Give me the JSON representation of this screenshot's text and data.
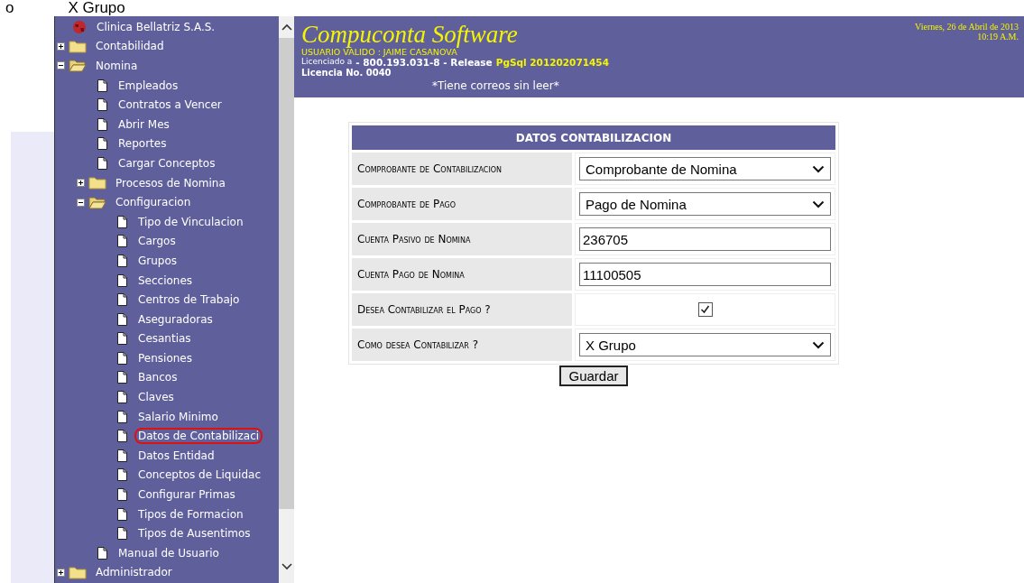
{
  "top_strip": {
    "bullet": "o",
    "text": "X Grupo"
  },
  "sidebar": {
    "tree": [
      {
        "label": "Clinica Bellatriz S.A.S.",
        "kind": "root",
        "selected": false,
        "children": [
          {
            "label": "Contabilidad",
            "kind": "folder",
            "expanded": false,
            "selected": false
          },
          {
            "label": "Nomina",
            "kind": "folder",
            "expanded": true,
            "selected": false,
            "children": [
              {
                "label": "Empleados",
                "kind": "page",
                "selected": false
              },
              {
                "label": "Contratos a Vencer",
                "kind": "page",
                "selected": false
              },
              {
                "label": "Abrir Mes",
                "kind": "page",
                "selected": false
              },
              {
                "label": "Reportes",
                "kind": "page",
                "selected": false
              },
              {
                "label": "Cargar Conceptos",
                "kind": "page",
                "selected": false
              },
              {
                "label": "Procesos de Nomina",
                "kind": "folder",
                "expanded": false,
                "selected": false
              },
              {
                "label": "Configuracion",
                "kind": "folder",
                "expanded": true,
                "selected": false,
                "children": [
                  {
                    "label": "Tipo de Vinculacion",
                    "kind": "page",
                    "selected": false
                  },
                  {
                    "label": "Cargos",
                    "kind": "page",
                    "selected": false
                  },
                  {
                    "label": "Grupos",
                    "kind": "page",
                    "selected": false
                  },
                  {
                    "label": "Secciones",
                    "kind": "page",
                    "selected": false
                  },
                  {
                    "label": "Centros de Trabajo",
                    "kind": "page",
                    "selected": false
                  },
                  {
                    "label": "Aseguradoras",
                    "kind": "page",
                    "selected": false
                  },
                  {
                    "label": "Cesantias",
                    "kind": "page",
                    "selected": false
                  },
                  {
                    "label": "Pensiones",
                    "kind": "page",
                    "selected": false
                  },
                  {
                    "label": "Bancos",
                    "kind": "page",
                    "selected": false
                  },
                  {
                    "label": "Claves",
                    "kind": "page",
                    "selected": false
                  },
                  {
                    "label": "Salario Minimo",
                    "kind": "page",
                    "selected": false
                  },
                  {
                    "label": "Datos de Contabilizaci",
                    "kind": "page",
                    "selected": true
                  },
                  {
                    "label": "Datos Entidad",
                    "kind": "page",
                    "selected": false
                  },
                  {
                    "label": "Conceptos de Liquidac",
                    "kind": "page",
                    "selected": false
                  },
                  {
                    "label": "Configurar Primas",
                    "kind": "page",
                    "selected": false
                  },
                  {
                    "label": "Tipos de Formacion",
                    "kind": "page",
                    "selected": false
                  },
                  {
                    "label": "Tipos de Ausentimos",
                    "kind": "page",
                    "selected": false
                  }
                ]
              },
              {
                "label": "Manual de Usuario",
                "kind": "page",
                "selected": false
              }
            ]
          },
          {
            "label": "Administrador",
            "kind": "folder",
            "expanded": false,
            "selected": false
          }
        ]
      }
    ]
  },
  "header": {
    "title": "Compuconta Software",
    "user": "USUARIO VALIDO : JAIME CASANOVA",
    "licensed_label": "Licenciado a",
    "license_id": "- 800.193.031-8 - Release",
    "release": "PgSql 201202071454",
    "license_no": "Licencia No. 0040",
    "mail_notice": "*Tiene correos sin leer*",
    "date": "Viernes, 26 de Abril de 2013",
    "time": "10:19 A.M."
  },
  "form": {
    "title": "DATOS CONTABILIZACION",
    "rows": [
      {
        "label": "Comprobante de Contabilizacion",
        "kind": "select",
        "value": "Comprobante de Nomina"
      },
      {
        "label": "Comprobante de Pago",
        "kind": "select",
        "value": "Pago de Nomina"
      },
      {
        "label": "Cuenta Pasivo de Nomina",
        "kind": "text",
        "value": "236705"
      },
      {
        "label": "Cuenta Pago de Nomina",
        "kind": "text",
        "value": "11100505"
      },
      {
        "label": "Desea Contabilizar el Pago ?",
        "kind": "checkbox",
        "checked": true
      },
      {
        "label": "Como desea Contabilizar ?",
        "kind": "select",
        "value": "X Grupo"
      }
    ],
    "button": "Guardar"
  }
}
